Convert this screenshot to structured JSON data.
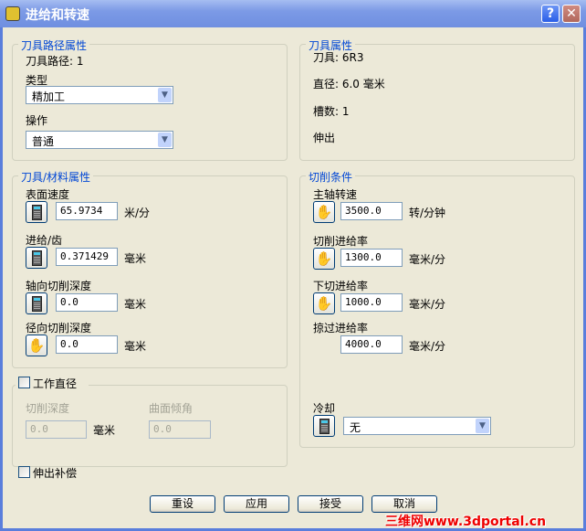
{
  "window": {
    "title": "进给和转速",
    "help": "?",
    "close": "✕"
  },
  "toolpath": {
    "legend": "刀具路径属性",
    "toolpath_label": "刀具路径: 1",
    "type_label": "类型",
    "type_value": "精加工",
    "op_label": "操作",
    "op_value": "普通"
  },
  "tool": {
    "legend": "刀具属性",
    "tool": "刀具: 6R3",
    "diameter": "直径: 6.0 毫米",
    "flutes": "槽数: 1",
    "overhang": "伸出"
  },
  "material": {
    "legend": "刀具/材料属性",
    "rows": [
      {
        "label": "表面速度",
        "value": "65.9734",
        "unit": "米/分",
        "icon": "calculator-icon"
      },
      {
        "label": "进给/齿",
        "value": "0.371429",
        "unit": "毫米",
        "icon": "calculator-icon"
      },
      {
        "label": "轴向切削深度",
        "value": "0.0",
        "unit": "毫米",
        "icon": "calculator-icon"
      },
      {
        "label": "径向切削深度",
        "value": "0.0",
        "unit": "毫米",
        "icon": "hand-icon"
      }
    ]
  },
  "cutting": {
    "legend": "切削条件",
    "rows": [
      {
        "label": "主轴转速",
        "value": "3500.0",
        "unit": "转/分钟",
        "icon": "hand-icon"
      },
      {
        "label": "切削进给率",
        "value": "1300.0",
        "unit": "毫米/分",
        "icon": "hand-icon"
      },
      {
        "label": "下切进给率",
        "value": "1000.0",
        "unit": "毫米/分",
        "icon": "hand-icon"
      },
      {
        "label": "掠过进给率",
        "value": "4000.0",
        "unit": "毫米/分"
      }
    ],
    "coolant_label": "冷却",
    "coolant_value": "无"
  },
  "working_diameter": {
    "label": "工作直径",
    "checked": false,
    "depth_label": "切削深度",
    "depth_value": "0.0",
    "depth_unit": "毫米",
    "angle_label": "曲面倾角",
    "angle_value": "0.0"
  },
  "overhang_comp": {
    "label": "伸出补偿",
    "checked": false
  },
  "buttons": {
    "reset": "重设",
    "apply": "应用",
    "accept": "接受",
    "cancel": "取消"
  },
  "watermark": "三维网www.3dportal.cn"
}
